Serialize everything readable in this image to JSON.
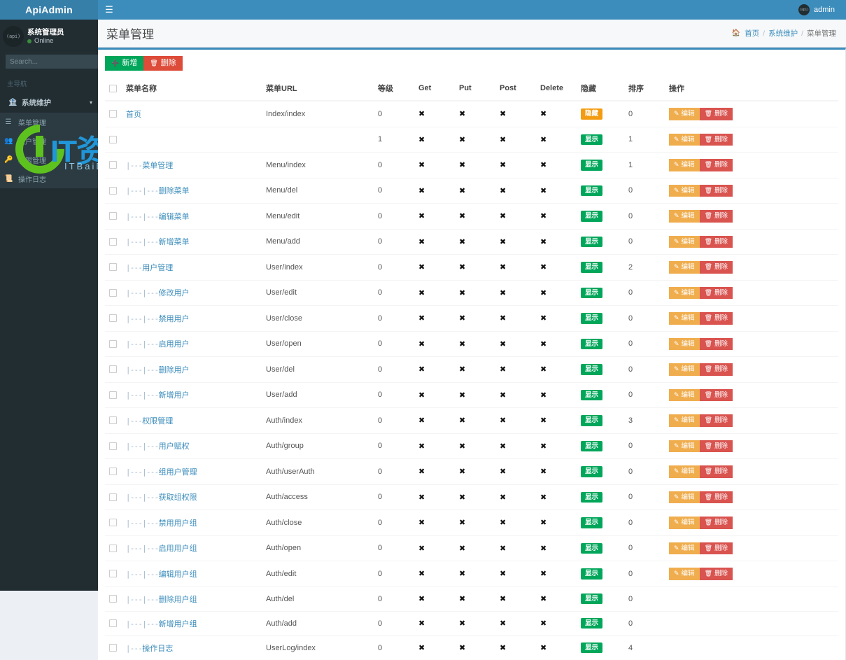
{
  "app": {
    "brand": "ApiAdmin",
    "hamburger_icon": "bars-icon",
    "nav_avatar_text": "(api)",
    "nav_username": "admin"
  },
  "sidebar": {
    "avatar_text": "(api)",
    "user_name": "系统管理员",
    "user_status": "Online",
    "search_placeholder": "Search...",
    "search_icon": "search-icon",
    "section_label": "主导航",
    "parent": {
      "icon": "bank-icon",
      "label": "系统维护",
      "caret_icon": "chevron-down-icon"
    },
    "items": [
      {
        "icon": "list-icon",
        "label": "菜单管理"
      },
      {
        "icon": "users-icon",
        "label": "用户管理"
      },
      {
        "icon": "key-icon",
        "label": "权限管理"
      },
      {
        "icon": "history-icon",
        "label": "操作日志"
      }
    ]
  },
  "header": {
    "title": "菜单管理",
    "breadcrumb": {
      "home_icon": "home-icon",
      "items": [
        "首页",
        "系统维护"
      ],
      "current": "菜单管理"
    }
  },
  "toolbar": {
    "add_label": "新增",
    "add_icon": "plus-icon",
    "delete_label": "删除",
    "delete_icon": "trash-icon"
  },
  "table": {
    "columns": [
      "菜单名称",
      "菜单URL",
      "等级",
      "Get",
      "Put",
      "Post",
      "Delete",
      "隐藏",
      "排序",
      "操作"
    ],
    "select_all_icon": "checkbox-icon",
    "xmark": "✖",
    "badge_show": "显示",
    "badge_hide": "隐藏",
    "edit_label": "编辑",
    "edit_icon": "pencil-icon",
    "del_label": "删除",
    "del_icon": "trash-icon",
    "rows": [
      {
        "prefix": "",
        "name": "首页",
        "url": "Index/index",
        "level": "0",
        "get": "✖",
        "put": "✖",
        "post": "✖",
        "delete": "✖",
        "hidden": "隐藏",
        "hidden_type": "hide",
        "sort": "0",
        "has_ops": true
      },
      {
        "prefix": "",
        "name": "",
        "url": "",
        "level": "1",
        "get": "✖",
        "put": "✖",
        "post": "✖",
        "delete": "✖",
        "hidden": "显示",
        "hidden_type": "show",
        "sort": "1",
        "has_ops": true
      },
      {
        "prefix": "|---",
        "name": "菜单管理",
        "url": "Menu/index",
        "level": "0",
        "get": "✖",
        "put": "✖",
        "post": "✖",
        "delete": "✖",
        "hidden": "显示",
        "hidden_type": "show",
        "sort": "1",
        "has_ops": true
      },
      {
        "prefix": "|---|---",
        "name": "删除菜单",
        "url": "Menu/del",
        "level": "0",
        "get": "✖",
        "put": "✖",
        "post": "✖",
        "delete": "✖",
        "hidden": "显示",
        "hidden_type": "show",
        "sort": "0",
        "has_ops": true
      },
      {
        "prefix": "|---|---",
        "name": "编辑菜单",
        "url": "Menu/edit",
        "level": "0",
        "get": "✖",
        "put": "✖",
        "post": "✖",
        "delete": "✖",
        "hidden": "显示",
        "hidden_type": "show",
        "sort": "0",
        "has_ops": true
      },
      {
        "prefix": "|---|---",
        "name": "新增菜单",
        "url": "Menu/add",
        "level": "0",
        "get": "✖",
        "put": "✖",
        "post": "✖",
        "delete": "✖",
        "hidden": "显示",
        "hidden_type": "show",
        "sort": "0",
        "has_ops": true
      },
      {
        "prefix": "|---",
        "name": "用户管理",
        "url": "User/index",
        "level": "0",
        "get": "✖",
        "put": "✖",
        "post": "✖",
        "delete": "✖",
        "hidden": "显示",
        "hidden_type": "show",
        "sort": "2",
        "has_ops": true
      },
      {
        "prefix": "|---|---",
        "name": "修改用户",
        "url": "User/edit",
        "level": "0",
        "get": "✖",
        "put": "✖",
        "post": "✖",
        "delete": "✖",
        "hidden": "显示",
        "hidden_type": "show",
        "sort": "0",
        "has_ops": true
      },
      {
        "prefix": "|---|---",
        "name": "禁用用户",
        "url": "User/close",
        "level": "0",
        "get": "✖",
        "put": "✖",
        "post": "✖",
        "delete": "✖",
        "hidden": "显示",
        "hidden_type": "show",
        "sort": "0",
        "has_ops": true
      },
      {
        "prefix": "|---|---",
        "name": "启用用户",
        "url": "User/open",
        "level": "0",
        "get": "✖",
        "put": "✖",
        "post": "✖",
        "delete": "✖",
        "hidden": "显示",
        "hidden_type": "show",
        "sort": "0",
        "has_ops": true
      },
      {
        "prefix": "|---|---",
        "name": "删除用户",
        "url": "User/del",
        "level": "0",
        "get": "✖",
        "put": "✖",
        "post": "✖",
        "delete": "✖",
        "hidden": "显示",
        "hidden_type": "show",
        "sort": "0",
        "has_ops": true
      },
      {
        "prefix": "|---|---",
        "name": "新增用户",
        "url": "User/add",
        "level": "0",
        "get": "✖",
        "put": "✖",
        "post": "✖",
        "delete": "✖",
        "hidden": "显示",
        "hidden_type": "show",
        "sort": "0",
        "has_ops": true
      },
      {
        "prefix": "|---",
        "name": "权限管理",
        "url": "Auth/index",
        "level": "0",
        "get": "✖",
        "put": "✖",
        "post": "✖",
        "delete": "✖",
        "hidden": "显示",
        "hidden_type": "show",
        "sort": "3",
        "has_ops": true
      },
      {
        "prefix": "|---|---",
        "name": "用户赋权",
        "url": "Auth/group",
        "level": "0",
        "get": "✖",
        "put": "✖",
        "post": "✖",
        "delete": "✖",
        "hidden": "显示",
        "hidden_type": "show",
        "sort": "0",
        "has_ops": true
      },
      {
        "prefix": "|---|---",
        "name": "组用户管理",
        "url": "Auth/userAuth",
        "level": "0",
        "get": "✖",
        "put": "✖",
        "post": "✖",
        "delete": "✖",
        "hidden": "显示",
        "hidden_type": "show",
        "sort": "0",
        "has_ops": true
      },
      {
        "prefix": "|---|---",
        "name": "获取组权限",
        "url": "Auth/access",
        "level": "0",
        "get": "✖",
        "put": "✖",
        "post": "✖",
        "delete": "✖",
        "hidden": "显示",
        "hidden_type": "show",
        "sort": "0",
        "has_ops": true
      },
      {
        "prefix": "|---|---",
        "name": "禁用用户组",
        "url": "Auth/close",
        "level": "0",
        "get": "✖",
        "put": "✖",
        "post": "✖",
        "delete": "✖",
        "hidden": "显示",
        "hidden_type": "show",
        "sort": "0",
        "has_ops": true
      },
      {
        "prefix": "|---|---",
        "name": "启用用户组",
        "url": "Auth/open",
        "level": "0",
        "get": "✖",
        "put": "✖",
        "post": "✖",
        "delete": "✖",
        "hidden": "显示",
        "hidden_type": "show",
        "sort": "0",
        "has_ops": true
      },
      {
        "prefix": "|---|---",
        "name": "编辑用户组",
        "url": "Auth/edit",
        "level": "0",
        "get": "✖",
        "put": "✖",
        "post": "✖",
        "delete": "✖",
        "hidden": "显示",
        "hidden_type": "show",
        "sort": "0",
        "has_ops": true
      },
      {
        "prefix": "|---|---",
        "name": "删除用户组",
        "url": "Auth/del",
        "level": "0",
        "get": "✖",
        "put": "✖",
        "post": "✖",
        "delete": "✖",
        "hidden": "显示",
        "hidden_type": "show",
        "sort": "0",
        "has_ops": false
      },
      {
        "prefix": "|---|---",
        "name": "新增用户组",
        "url": "Auth/add",
        "level": "0",
        "get": "✖",
        "put": "✖",
        "post": "✖",
        "delete": "✖",
        "hidden": "显示",
        "hidden_type": "show",
        "sort": "0",
        "has_ops": false
      },
      {
        "prefix": "|---",
        "name": "操作日志",
        "url": "UserLog/index",
        "level": "0",
        "get": "✖",
        "put": "✖",
        "post": "✖",
        "delete": "✖",
        "hidden": "显示",
        "hidden_type": "show",
        "sort": "4",
        "has_ops": false
      }
    ]
  },
  "watermark": {
    "text": "IT资源网",
    "sub": "ITBaiDu!cOm"
  },
  "colors": {
    "brand": "#3c8dbc",
    "brand_dark": "#367fa9",
    "sidebar": "#222d32",
    "success": "#00a65a",
    "danger": "#dd4b39",
    "edit": "#f0ad4e",
    "warning": "#f39c12"
  }
}
